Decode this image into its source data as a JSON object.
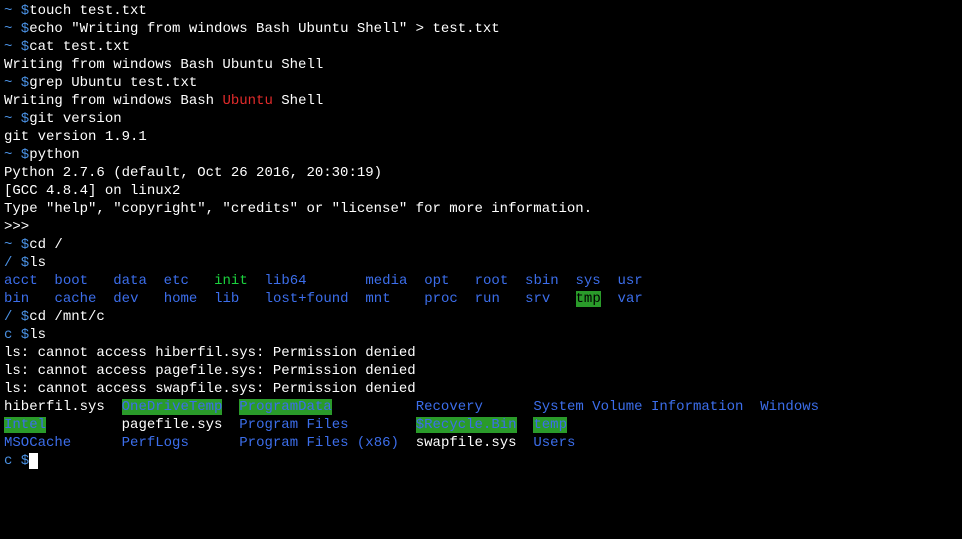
{
  "lines": {
    "l1_prompt": "~ $",
    "l1_cmd": "touch test.txt",
    "l2_prompt": "~ $",
    "l2_cmd": "echo \"Writing from windows Bash Ubuntu Shell\" > test.txt",
    "l3_prompt": "~ $",
    "l3_cmd": "cat test.txt",
    "l4": "Writing from windows Bash Ubuntu Shell",
    "l5_prompt": "~ $",
    "l5_cmd": "grep Ubuntu test.txt",
    "l6_part1": "Writing from windows Bash ",
    "l6_part2": "Ubuntu",
    "l6_part3": " Shell",
    "l7_prompt": "~ $",
    "l7_cmd": "git version",
    "l8": "git version 1.9.1",
    "l9_prompt": "~ $",
    "l9_cmd": "python",
    "l10": "Python 2.7.6 (default, Oct 26 2016, 20:30:19)",
    "l11": "[GCC 4.8.4] on linux2",
    "l12": "Type \"help\", \"copyright\", \"credits\" or \"license\" for more information.",
    "l13": ">>>",
    "l14_prompt": "~ $",
    "l14_cmd": "cd /",
    "l15_prompt": "/ $",
    "l15_cmd": "ls",
    "root_ls_r1": {
      "acct": "acct",
      "boot": "boot",
      "data": "data",
      "etc": "etc",
      "init": "init",
      "lib64": "lib64",
      "media": "media",
      "opt": "opt",
      "root": "root",
      "sbin": "sbin",
      "sys": "sys",
      "usr": "usr"
    },
    "root_ls_r2": {
      "bin": "bin",
      "cache": "cache",
      "dev": "dev",
      "home": "home",
      "lib": "lib",
      "lostfound": "lost+found",
      "mnt": "mnt",
      "proc": "proc",
      "run": "run",
      "srv": "srv",
      "tmp": "tmp",
      "var": "var"
    },
    "l18_prompt": "/ $",
    "l18_cmd": "cd /mnt/c",
    "l19_prompt": "c $",
    "l19_cmd": "ls",
    "l20": "ls: cannot access hiberfil.sys: Permission denied",
    "l21": "ls: cannot access pagefile.sys: Permission denied",
    "l22": "ls: cannot access swapfile.sys: Permission denied",
    "c_ls_r1": {
      "hiberfil": "hiberfil.sys",
      "onedrive": "OneDriveTemp",
      "programdata": "ProgramData",
      "recovery": "Recovery",
      "sysvol": "System Volume Information",
      "windows": "Windows"
    },
    "c_ls_r2": {
      "intel": "Intel",
      "pagefile": "pagefile.sys",
      "progfiles": "Program Files",
      "recycle": "$Recycle.Bin",
      "temp": "temp"
    },
    "c_ls_r3": {
      "msocache": "MSOCache",
      "perflogs": "PerfLogs",
      "progfiles86": "Program Files (x86)",
      "swapfile": "swapfile.sys",
      "users": "Users"
    },
    "l26_prompt": "c $",
    "cursor": " "
  }
}
